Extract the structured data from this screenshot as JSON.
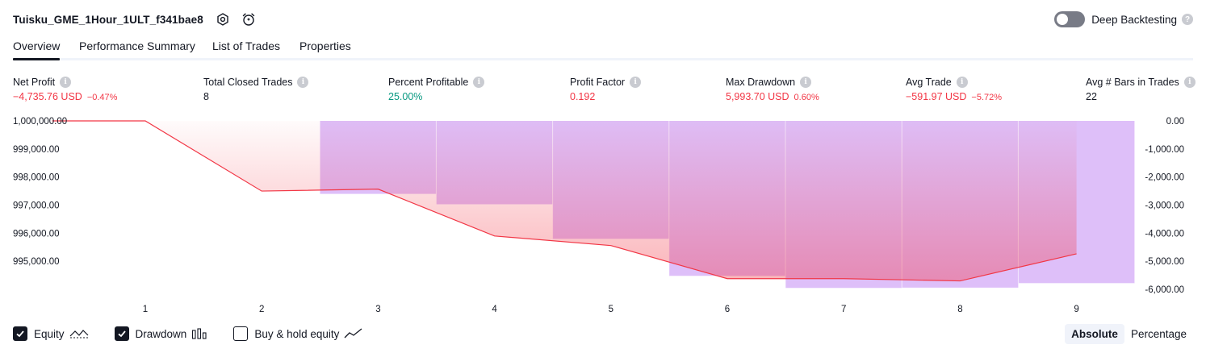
{
  "header": {
    "title": "Tuisku_GME_1Hour_1ULT_f341bae8",
    "settings_icon": "gear-icon",
    "alert_icon": "alarm-clock-plus-icon"
  },
  "deep_backtesting": {
    "label": "Deep Backtesting",
    "enabled": false,
    "help": "?"
  },
  "tabs": [
    {
      "label": "Overview",
      "active": true
    },
    {
      "label": "Performance Summary",
      "active": false
    },
    {
      "label": "List of Trades",
      "active": false
    },
    {
      "label": "Properties",
      "active": false
    }
  ],
  "metrics": [
    {
      "label": "Net Profit",
      "value": "−4,735.76 USD",
      "pct": "−0.47%",
      "tone": "neg"
    },
    {
      "label": "Total Closed Trades",
      "value": "8",
      "pct": "",
      "tone": "neutral"
    },
    {
      "label": "Percent Profitable",
      "value": "25.00%",
      "pct": "",
      "tone": "pos"
    },
    {
      "label": "Profit Factor",
      "value": "0.192",
      "pct": "",
      "tone": "neg"
    },
    {
      "label": "Max Drawdown",
      "value": "5,993.70 USD",
      "pct": "0.60%",
      "tone": "neg"
    },
    {
      "label": "Avg Trade",
      "value": "−591.97 USD",
      "pct": "−5.72%",
      "tone": "neg"
    },
    {
      "label": "Avg # Bars in Trades",
      "value": "22",
      "pct": "",
      "tone": "neutral"
    }
  ],
  "chart_data": {
    "type": "line",
    "x_ticks": [
      "1",
      "2",
      "3",
      "4",
      "5",
      "6",
      "7",
      "8",
      "9"
    ],
    "left_axis": {
      "ticks": [
        "1,000,000.00",
        "999,000.00",
        "998,000.00",
        "997,000.00",
        "996,000.00",
        "995,000.00"
      ],
      "ylim": [
        994000,
        1000000
      ]
    },
    "right_axis": {
      "ticks": [
        "0.00",
        "-1,000.00",
        "-2,000.00",
        "-3,000.00",
        "-4,000.00",
        "-5,000.00",
        "-6,000.00"
      ],
      "ylim": [
        -6000,
        0
      ]
    },
    "series": [
      {
        "name": "Equity",
        "x": [
          0.2,
          1,
          2,
          3,
          4,
          5,
          6,
          7,
          8,
          9
        ],
        "values": [
          1000000,
          1000000,
          997500,
          997570,
          995900,
          995560,
          994380,
          994380,
          994300,
          995264
        ],
        "color": "#f23645"
      },
      {
        "name": "Drawdown",
        "values": [
          0,
          -2600,
          -2970,
          -4200,
          -5520,
          -5950,
          -5940,
          -5780,
          -5770
        ],
        "color": "#d8b4f8"
      }
    ]
  },
  "footer": {
    "items": [
      {
        "label": "Equity",
        "checked": true
      },
      {
        "label": "Drawdown",
        "checked": true
      },
      {
        "label": "Buy & hold equity",
        "checked": false
      }
    ],
    "modes": [
      {
        "label": "Absolute",
        "active": true
      },
      {
        "label": "Percentage",
        "active": false
      }
    ]
  }
}
